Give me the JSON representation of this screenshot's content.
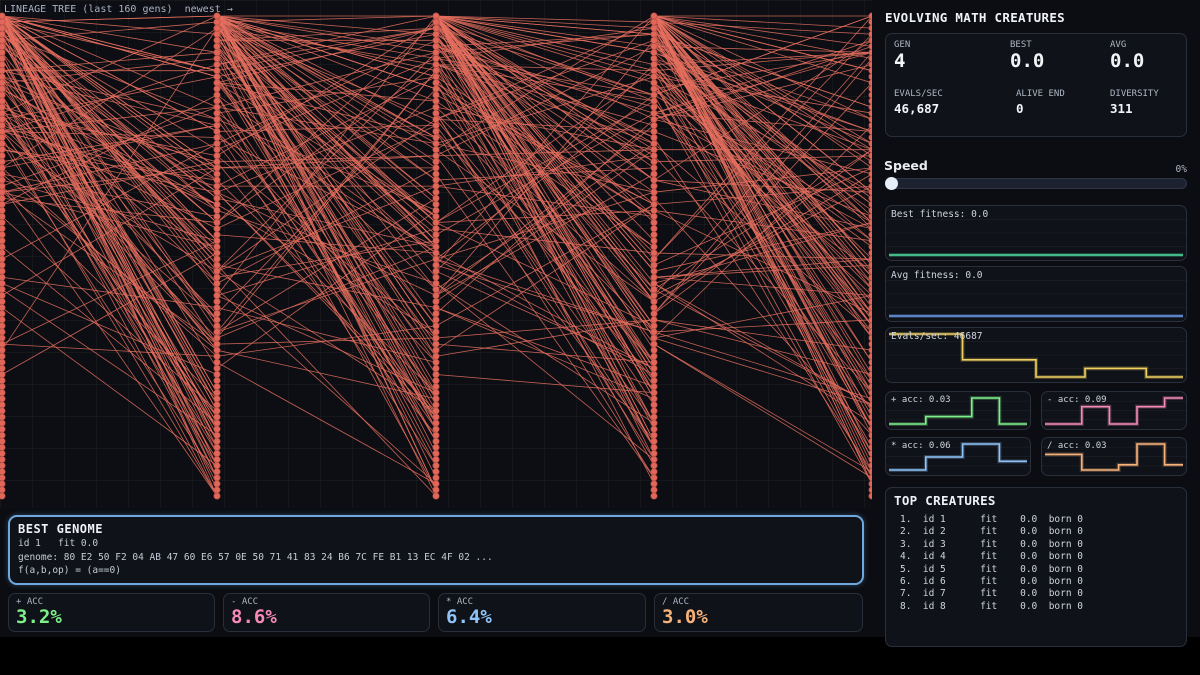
{
  "lineage": {
    "title": "LINEAGE TREE (last 160 gens)  newest →",
    "node_color": "#e0675a",
    "line_color": "#e8705f"
  },
  "best_genome": {
    "title": "BEST GENOME",
    "id_line": "id 1   fit 0.0",
    "genome_line": "genome: 80 E2 50 F2 04 AB 47 60 E6 57 0E 50 71 41 83 24 B6 7C FE B1 13 EC 4F 02 ...",
    "expr_line": "f(a,b,op) = (a==0)"
  },
  "acc_cards": [
    {
      "label": "+ ACC",
      "value": "3.2%",
      "color": "#7ef08a"
    },
    {
      "label": "- ACC",
      "value": "8.6%",
      "color": "#f58ab8"
    },
    {
      "label": "* ACC",
      "value": "6.4%",
      "color": "#8fc4f8"
    },
    {
      "label": "/ ACC",
      "value": "3.0%",
      "color": "#f7b27a"
    }
  ],
  "app_title": "EVOLVING MATH CREATURES",
  "stats": {
    "gen_label": "GEN",
    "gen": "4",
    "best_label": "BEST",
    "best": "0.0",
    "avg_label": "AVG",
    "avg": "0.0",
    "evals_label": "EVALS/SEC",
    "evals": "46,687",
    "alive_label": "ALIVE END",
    "alive": "0",
    "diversity_label": "DIVERSITY",
    "diversity": "311"
  },
  "speed": {
    "label": "Speed",
    "value_text": "0%",
    "value": 0
  },
  "charts": {
    "best": {
      "label": "Best fitness: 0.0",
      "color": "#4fe0a0",
      "values": [
        0,
        0,
        0,
        0,
        0,
        0,
        0,
        0,
        0,
        0
      ]
    },
    "avg": {
      "label": "Avg fitness: 0.0",
      "color": "#6f9cf0",
      "values": [
        0,
        0,
        0,
        0,
        0,
        0,
        0,
        0,
        0,
        0
      ]
    },
    "evals": {
      "label": "Evals/sec: 46687",
      "color": "#f0d060",
      "values": [
        52000,
        52000,
        52000,
        52000,
        52000,
        52000,
        46000,
        46000,
        46000,
        46000,
        46000,
        46000,
        42000,
        42000,
        42000,
        42000,
        44000,
        44000,
        44000,
        44000,
        44000,
        42000,
        42000,
        42000,
        42000
      ]
    },
    "plus": {
      "label": "+ acc: 0.03",
      "color": "#7ef08a",
      "values": [
        0.03,
        0.03,
        0.03,
        0.03,
        0.05,
        0.05,
        0.05,
        0.05,
        0.05,
        0.1,
        0.1,
        0.1,
        0.03,
        0.03,
        0.03,
        0.03
      ]
    },
    "minus": {
      "label": "- acc: 0.09",
      "color": "#f58ab8",
      "values": [
        0.06,
        0.06,
        0.06,
        0.06,
        0.1,
        0.1,
        0.1,
        0.06,
        0.06,
        0.06,
        0.1,
        0.1,
        0.1,
        0.12,
        0.12,
        0.12
      ]
    },
    "mul": {
      "label": "* acc: 0.06",
      "color": "#8fc4f8",
      "values": [
        0.03,
        0.03,
        0.03,
        0.03,
        0.06,
        0.06,
        0.06,
        0.06,
        0.09,
        0.09,
        0.09,
        0.09,
        0.05,
        0.05,
        0.05,
        0.05
      ]
    },
    "div": {
      "label": "/ acc: 0.03",
      "color": "#f7b27a",
      "values": [
        0.05,
        0.05,
        0.05,
        0.05,
        0.02,
        0.02,
        0.02,
        0.02,
        0.03,
        0.03,
        0.07,
        0.07,
        0.07,
        0.03,
        0.03,
        0.03
      ]
    }
  },
  "top": {
    "title": "TOP CREATURES",
    "rows": [
      "1.  id 1      fit    0.0  born 0",
      "2.  id 2      fit    0.0  born 0",
      "3.  id 3      fit    0.0  born 0",
      "4.  id 4      fit    0.0  born 0",
      "5.  id 5      fit    0.0  born 0",
      "6.  id 6      fit    0.0  born 0",
      "7.  id 7      fit    0.0  born 0",
      "8.  id 8      fit    0.0  born 0"
    ]
  }
}
